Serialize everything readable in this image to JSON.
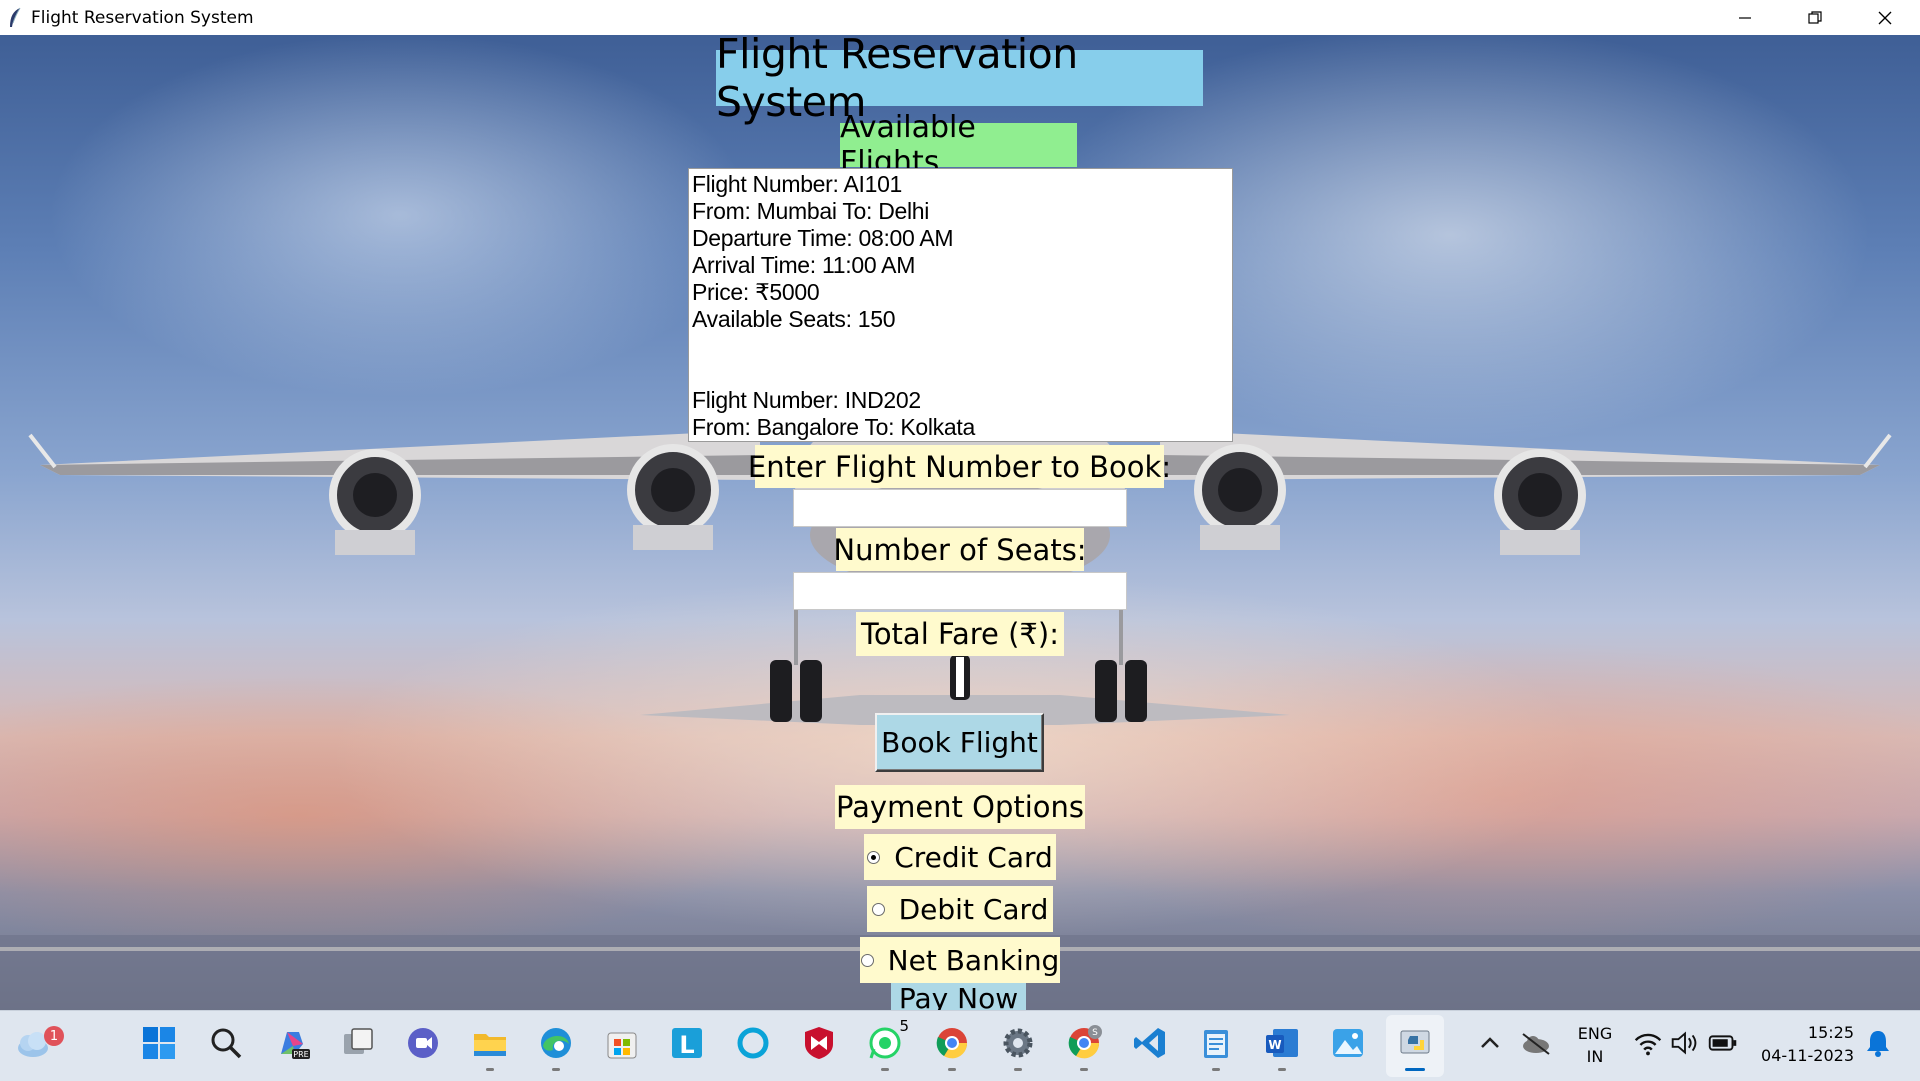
{
  "window": {
    "title": "Flight Reservation System",
    "controls": [
      "minimize-icon",
      "restore-icon",
      "close-icon"
    ]
  },
  "app": {
    "title": "Flight Reservation System",
    "available_flights_label": "Available Flights",
    "flight_list_lines": [
      "Flight Number: AI101",
      "From: Mumbai To: Delhi",
      "Departure Time: 08:00 AM",
      "Arrival Time: 11:00 AM",
      "Price: ₹5000",
      "Available Seats: 150",
      "",
      "",
      "Flight Number: IND202",
      "From: Bangalore To: Kolkata"
    ],
    "flight_number_label": "Enter Flight Number to Book:",
    "flight_number_value": "",
    "seats_label": "Number of Seats:",
    "seats_value": "",
    "total_fare_label": "Total Fare (₹):",
    "total_fare_value": "",
    "book_button": "Book Flight",
    "payment_label": "Payment Options",
    "payment_options": [
      {
        "label": "Credit Card",
        "selected": true
      },
      {
        "label": "Debit Card",
        "selected": false
      },
      {
        "label": "Net Banking",
        "selected": false
      }
    ],
    "pay_now_button": "Pay Now"
  },
  "taskbar": {
    "weather_badge": "1",
    "apps": [
      "windows-start-icon",
      "search-icon",
      "copilot-icon",
      "task-view-icon",
      "teams-chat-icon",
      "file-explorer-icon",
      "edge-icon",
      "microsoft-store-icon",
      "launcher-l-icon",
      "cortana-icon",
      "mcafee-icon",
      "whatsapp-icon",
      "chrome-icon",
      "settings-icon",
      "chrome-profile-icon",
      "vscode-icon",
      "notepad-icon",
      "word-icon",
      "photos-icon",
      "python-icon"
    ],
    "whatsapp_badge": "5",
    "chrome_profile_badge": "S",
    "language": "ENG",
    "region": "IN",
    "time": "15:25",
    "date": "04-11-2023"
  }
}
